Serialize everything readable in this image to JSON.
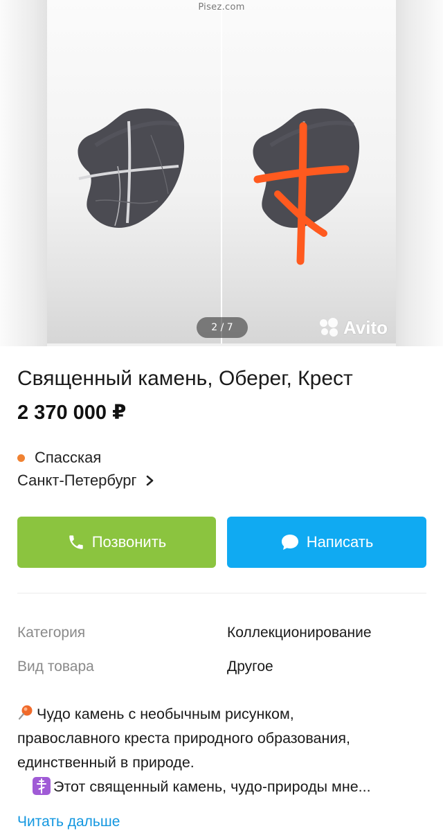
{
  "gallery": {
    "watermark": "Pisez.com",
    "counter": "2 / 7",
    "brand": "Avito",
    "brand_icon": "avito-logo",
    "accent": "#ff5a1f"
  },
  "listing": {
    "title": "Священный камень, Оберег, Крест",
    "price": "2 370 000 ₽"
  },
  "location": {
    "metro": "Спасская",
    "metro_color": "#f08232",
    "city": "Санкт-Петербург"
  },
  "actions": {
    "call_label": "Позвонить",
    "call_icon": "phone-icon",
    "call_color": "#8bc43f",
    "message_label": "Написать",
    "message_icon": "chat-bubble-icon",
    "message_color": "#10aaf2"
  },
  "params": [
    {
      "label": "Категория",
      "value": "Коллекционирование"
    },
    {
      "label": "Вид товара",
      "value": "Другое"
    }
  ],
  "description": {
    "lines": [
      "Чудо камень с необычным рисунком,",
      "православного креста природного образования,",
      "единственный в природе.",
      "Этот священный камень, чудо-природы мне..."
    ],
    "read_more": "Читать дальше"
  }
}
